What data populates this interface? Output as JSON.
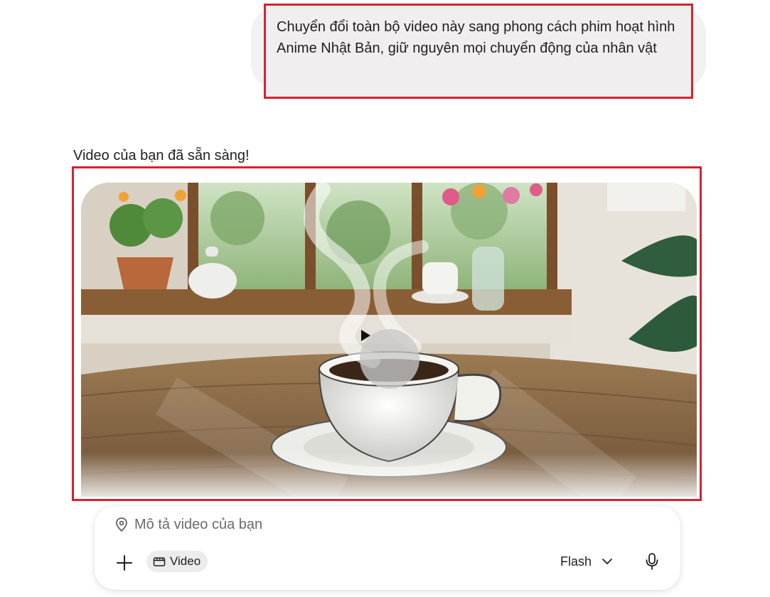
{
  "conversation": {
    "user_message": "Chuyển đổi toàn bộ video này sang phong cách phim hoạt hình Anime Nhật Bản, giữ nguyên mọi chuyển động của nhân vật",
    "assistant_reply": "Video của bạn đã sẵn sàng!"
  },
  "video": {
    "play_icon": "play-icon"
  },
  "composer": {
    "placeholder": "Mô tả video của bạn",
    "location_icon": "location-pin-icon",
    "add_icon": "plus-icon",
    "video_chip_label": "Video",
    "video_chip_icon": "video-icon",
    "model_label": "Flash",
    "model_icon": "chevron-down-icon",
    "mic_icon": "microphone-icon"
  },
  "colors": {
    "highlight_border": "#d6232f",
    "user_bubble_bg": "#f0eeee",
    "chip_bg": "#ececec"
  }
}
